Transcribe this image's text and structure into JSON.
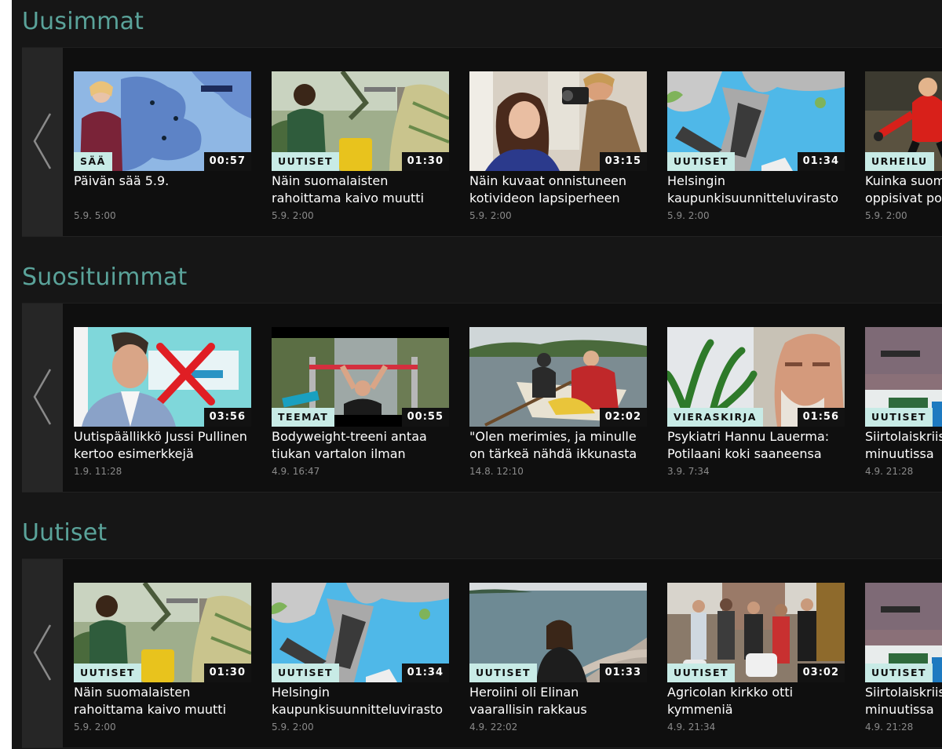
{
  "colors": {
    "background": "#161616",
    "shelf": "#0f0f0f",
    "section_title": "#5aa39a",
    "badge_bg": "#c8ebe6",
    "duration_bg": "#121212",
    "date_text": "#8a8a8a"
  },
  "sections": [
    {
      "title": "Uusimmat",
      "cards": [
        {
          "category": "SÄÄ",
          "duration": "00:57",
          "title": "Päivän sää 5.9.",
          "date": "5.9. 5:00",
          "thumbnail": "weather-map"
        },
        {
          "category": "UUTISET",
          "duration": "01:30",
          "title": "Näin suomalaisten\nrahoittama kaivo muutti",
          "date": "5.9. 2:00",
          "thumbnail": "water-well"
        },
        {
          "category": "",
          "duration": "03:15",
          "title": "Näin kuvaat onnistuneen\nkotivideon lapsiperheen",
          "date": "5.9. 2:00",
          "thumbnail": "home-video"
        },
        {
          "category": "UUTISET",
          "duration": "01:34",
          "title": "Helsingin\nkaupunkisuunnitteluvirasto",
          "date": "5.9. 2:00",
          "thumbnail": "city-plan"
        },
        {
          "category": "URHEILU",
          "duration": "",
          "title": "Kuinka suomalaiset\noppisivat potkimaan",
          "date": "5.9. 2:00",
          "thumbnail": "football"
        }
      ]
    },
    {
      "title": "Suosituimmat",
      "cards": [
        {
          "category": "",
          "duration": "03:56",
          "title": "Uutispäällikkö Jussi Pullinen\nkertoo esimerkkejä",
          "date": "1.9. 11:28",
          "thumbnail": "interview-cross"
        },
        {
          "category": "TEEMAT",
          "duration": "00:55",
          "title": "Bodyweight-treeni antaa\ntiukan vartalon ilman",
          "date": "4.9. 16:47",
          "thumbnail": "pullup-bar"
        },
        {
          "category": "",
          "duration": "02:02",
          "title": "\"Olen merimies, ja minulle\non tärkeä nähdä ikkunasta",
          "date": "14.8. 12:10",
          "thumbnail": "boat-lake"
        },
        {
          "category": "VIERASKIRJA",
          "duration": "01:56",
          "title": "Psykiatri Hannu Lauerma:\nPotilaani koki saaneensa",
          "date": "3.9. 7:34",
          "thumbnail": "portrait-plant"
        },
        {
          "category": "UUTISET",
          "duration": "",
          "title": "Siirtolaiskriisi\nminuutissa",
          "date": "4.9. 21:28",
          "thumbnail": "migrant-boat"
        }
      ]
    },
    {
      "title": "Uutiset",
      "cards": [
        {
          "category": "UUTISET",
          "duration": "01:30",
          "title": "Näin suomalaisten\nrahoittama kaivo muutti",
          "date": "5.9. 2:00",
          "thumbnail": "water-well"
        },
        {
          "category": "UUTISET",
          "duration": "01:34",
          "title": "Helsingin\nkaupunkisuunnitteluvirasto",
          "date": "5.9. 2:00",
          "thumbnail": "city-plan"
        },
        {
          "category": "UUTISET",
          "duration": "01:33",
          "title": "Heroiini oli Elinan\nvaarallisin rakkaus",
          "date": "4.9. 22:02",
          "thumbnail": "sea-shore"
        },
        {
          "category": "UUTISET",
          "duration": "03:02",
          "title": "Agricolan kirkko otti\nkymmeniä",
          "date": "4.9. 21:34",
          "thumbnail": "crowd-street"
        },
        {
          "category": "UUTISET",
          "duration": "",
          "title": "Siirtolaiskriisi\nminuutissa",
          "date": "4.9. 21:28",
          "thumbnail": "migrant-boat"
        }
      ]
    }
  ]
}
